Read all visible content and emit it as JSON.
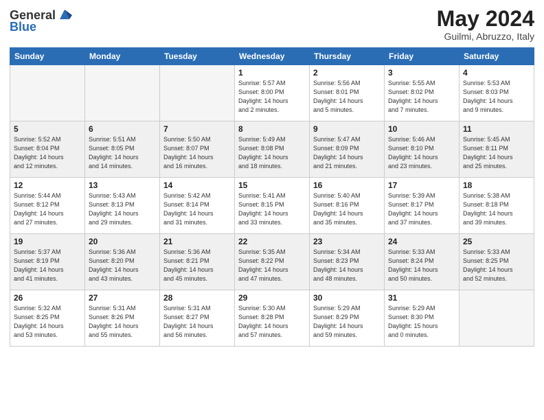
{
  "header": {
    "logo_general": "General",
    "logo_blue": "Blue",
    "month_title": "May 2024",
    "location": "Guilmi, Abruzzo, Italy"
  },
  "days_of_week": [
    "Sunday",
    "Monday",
    "Tuesday",
    "Wednesday",
    "Thursday",
    "Friday",
    "Saturday"
  ],
  "weeks": [
    {
      "shaded": false,
      "days": [
        {
          "num": "",
          "info": ""
        },
        {
          "num": "",
          "info": ""
        },
        {
          "num": "",
          "info": ""
        },
        {
          "num": "1",
          "info": "Sunrise: 5:57 AM\nSunset: 8:00 PM\nDaylight: 14 hours\nand 2 minutes."
        },
        {
          "num": "2",
          "info": "Sunrise: 5:56 AM\nSunset: 8:01 PM\nDaylight: 14 hours\nand 5 minutes."
        },
        {
          "num": "3",
          "info": "Sunrise: 5:55 AM\nSunset: 8:02 PM\nDaylight: 14 hours\nand 7 minutes."
        },
        {
          "num": "4",
          "info": "Sunrise: 5:53 AM\nSunset: 8:03 PM\nDaylight: 14 hours\nand 9 minutes."
        }
      ]
    },
    {
      "shaded": true,
      "days": [
        {
          "num": "5",
          "info": "Sunrise: 5:52 AM\nSunset: 8:04 PM\nDaylight: 14 hours\nand 12 minutes."
        },
        {
          "num": "6",
          "info": "Sunrise: 5:51 AM\nSunset: 8:05 PM\nDaylight: 14 hours\nand 14 minutes."
        },
        {
          "num": "7",
          "info": "Sunrise: 5:50 AM\nSunset: 8:07 PM\nDaylight: 14 hours\nand 16 minutes."
        },
        {
          "num": "8",
          "info": "Sunrise: 5:49 AM\nSunset: 8:08 PM\nDaylight: 14 hours\nand 18 minutes."
        },
        {
          "num": "9",
          "info": "Sunrise: 5:47 AM\nSunset: 8:09 PM\nDaylight: 14 hours\nand 21 minutes."
        },
        {
          "num": "10",
          "info": "Sunrise: 5:46 AM\nSunset: 8:10 PM\nDaylight: 14 hours\nand 23 minutes."
        },
        {
          "num": "11",
          "info": "Sunrise: 5:45 AM\nSunset: 8:11 PM\nDaylight: 14 hours\nand 25 minutes."
        }
      ]
    },
    {
      "shaded": false,
      "days": [
        {
          "num": "12",
          "info": "Sunrise: 5:44 AM\nSunset: 8:12 PM\nDaylight: 14 hours\nand 27 minutes."
        },
        {
          "num": "13",
          "info": "Sunrise: 5:43 AM\nSunset: 8:13 PM\nDaylight: 14 hours\nand 29 minutes."
        },
        {
          "num": "14",
          "info": "Sunrise: 5:42 AM\nSunset: 8:14 PM\nDaylight: 14 hours\nand 31 minutes."
        },
        {
          "num": "15",
          "info": "Sunrise: 5:41 AM\nSunset: 8:15 PM\nDaylight: 14 hours\nand 33 minutes."
        },
        {
          "num": "16",
          "info": "Sunrise: 5:40 AM\nSunset: 8:16 PM\nDaylight: 14 hours\nand 35 minutes."
        },
        {
          "num": "17",
          "info": "Sunrise: 5:39 AM\nSunset: 8:17 PM\nDaylight: 14 hours\nand 37 minutes."
        },
        {
          "num": "18",
          "info": "Sunrise: 5:38 AM\nSunset: 8:18 PM\nDaylight: 14 hours\nand 39 minutes."
        }
      ]
    },
    {
      "shaded": true,
      "days": [
        {
          "num": "19",
          "info": "Sunrise: 5:37 AM\nSunset: 8:19 PM\nDaylight: 14 hours\nand 41 minutes."
        },
        {
          "num": "20",
          "info": "Sunrise: 5:36 AM\nSunset: 8:20 PM\nDaylight: 14 hours\nand 43 minutes."
        },
        {
          "num": "21",
          "info": "Sunrise: 5:36 AM\nSunset: 8:21 PM\nDaylight: 14 hours\nand 45 minutes."
        },
        {
          "num": "22",
          "info": "Sunrise: 5:35 AM\nSunset: 8:22 PM\nDaylight: 14 hours\nand 47 minutes."
        },
        {
          "num": "23",
          "info": "Sunrise: 5:34 AM\nSunset: 8:23 PM\nDaylight: 14 hours\nand 48 minutes."
        },
        {
          "num": "24",
          "info": "Sunrise: 5:33 AM\nSunset: 8:24 PM\nDaylight: 14 hours\nand 50 minutes."
        },
        {
          "num": "25",
          "info": "Sunrise: 5:33 AM\nSunset: 8:25 PM\nDaylight: 14 hours\nand 52 minutes."
        }
      ]
    },
    {
      "shaded": false,
      "days": [
        {
          "num": "26",
          "info": "Sunrise: 5:32 AM\nSunset: 8:25 PM\nDaylight: 14 hours\nand 53 minutes."
        },
        {
          "num": "27",
          "info": "Sunrise: 5:31 AM\nSunset: 8:26 PM\nDaylight: 14 hours\nand 55 minutes."
        },
        {
          "num": "28",
          "info": "Sunrise: 5:31 AM\nSunset: 8:27 PM\nDaylight: 14 hours\nand 56 minutes."
        },
        {
          "num": "29",
          "info": "Sunrise: 5:30 AM\nSunset: 8:28 PM\nDaylight: 14 hours\nand 57 minutes."
        },
        {
          "num": "30",
          "info": "Sunrise: 5:29 AM\nSunset: 8:29 PM\nDaylight: 14 hours\nand 59 minutes."
        },
        {
          "num": "31",
          "info": "Sunrise: 5:29 AM\nSunset: 8:30 PM\nDaylight: 15 hours\nand 0 minutes."
        },
        {
          "num": "",
          "info": ""
        }
      ]
    }
  ]
}
